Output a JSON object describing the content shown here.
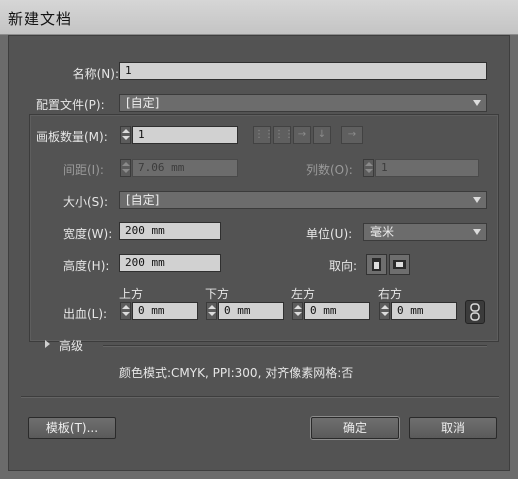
{
  "window": {
    "title": "新建文档"
  },
  "name": {
    "label": "名称(N):",
    "value": "1"
  },
  "profile": {
    "label": "配置文件(P):",
    "value": "[自定]"
  },
  "artboards": {
    "count_label": "画板数量(M):",
    "count_value": "1",
    "spacing_label": "间距(I):",
    "spacing_value": "7.06 mm",
    "columns_label": "列数(O):",
    "columns_value": "1"
  },
  "size": {
    "label": "大小(S):",
    "value": "[自定]"
  },
  "width": {
    "label": "宽度(W):",
    "value": "200 mm"
  },
  "height": {
    "label": "高度(H):",
    "value": "200 mm"
  },
  "units": {
    "label": "单位(U):",
    "value": "毫米"
  },
  "orientation": {
    "label": "取向:"
  },
  "bleed": {
    "label": "出血(L):",
    "top_label": "上方",
    "top_value": "0 mm",
    "bottom_label": "下方",
    "bottom_value": "0 mm",
    "left_label": "左方",
    "left_value": "0 mm",
    "right_label": "右方",
    "right_value": "0 mm"
  },
  "advanced": {
    "label": "高级",
    "summary": "颜色模式:CMYK, PPI:300, 对齐像素网格:否"
  },
  "buttons": {
    "templates": "模板(T)...",
    "ok": "确定",
    "cancel": "取消"
  },
  "icons": [
    "grid-by-row-icon",
    "grid-by-column-icon",
    "arrange-by-row-icon",
    "arrange-by-column-icon",
    "right-to-left-icon",
    "portrait-icon",
    "landscape-icon",
    "link-icon",
    "disclosure-triangle-icon"
  ]
}
